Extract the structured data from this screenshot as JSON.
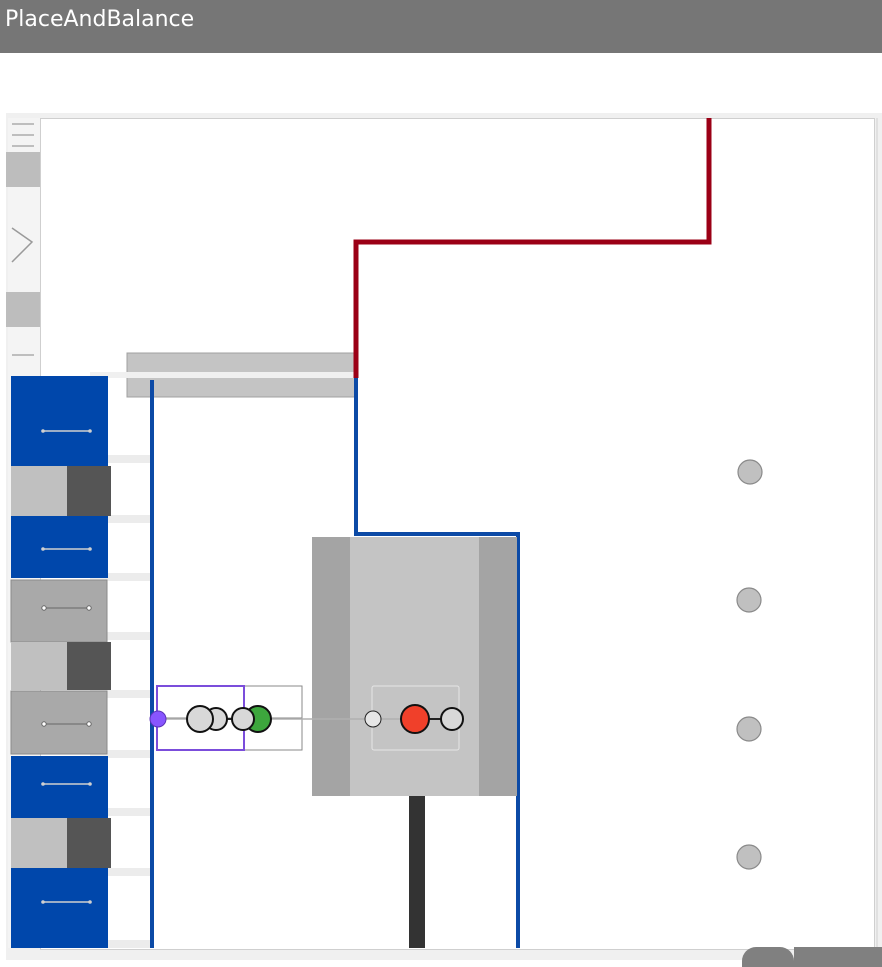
{
  "app": {
    "title": "PlaceAndBalance"
  },
  "colors": {
    "titlebar": "#767676",
    "title_text": "#ffffff",
    "wire_red": "#9b0016",
    "wire_blue": "#0c4aa6",
    "block_blue": "#0047ab",
    "block_light_gray": "#c0c0c0",
    "block_dark_gray": "#555555",
    "block_mid_gray": "#a9a9a9",
    "panel_gray": "#c4c4c4",
    "panel_side_gray": "#a4a4a4",
    "post_black": "#333333",
    "node_gray": "#d8d8d8",
    "node_green": "#3da63d",
    "node_red": "#f0402a",
    "node_purple": "#8855ff",
    "marker_gray": "#c0c0c0"
  },
  "canvas": {
    "left_toolbar": [
      "toolbar-button",
      "toolbar-button",
      "toolbar-button",
      "toolbar-button",
      "toolbar-button",
      "toolbar-button"
    ],
    "left_column_blocks": [
      {
        "kind": "blue-block"
      },
      {
        "kind": "gray-split-block"
      },
      {
        "kind": "blue-block"
      },
      {
        "kind": "gray-link-block"
      },
      {
        "kind": "gray-split-block"
      },
      {
        "kind": "gray-link-block"
      },
      {
        "kind": "blue-block"
      },
      {
        "kind": "gray-split-block"
      },
      {
        "kind": "blue-block"
      }
    ],
    "right_markers": 4
  }
}
